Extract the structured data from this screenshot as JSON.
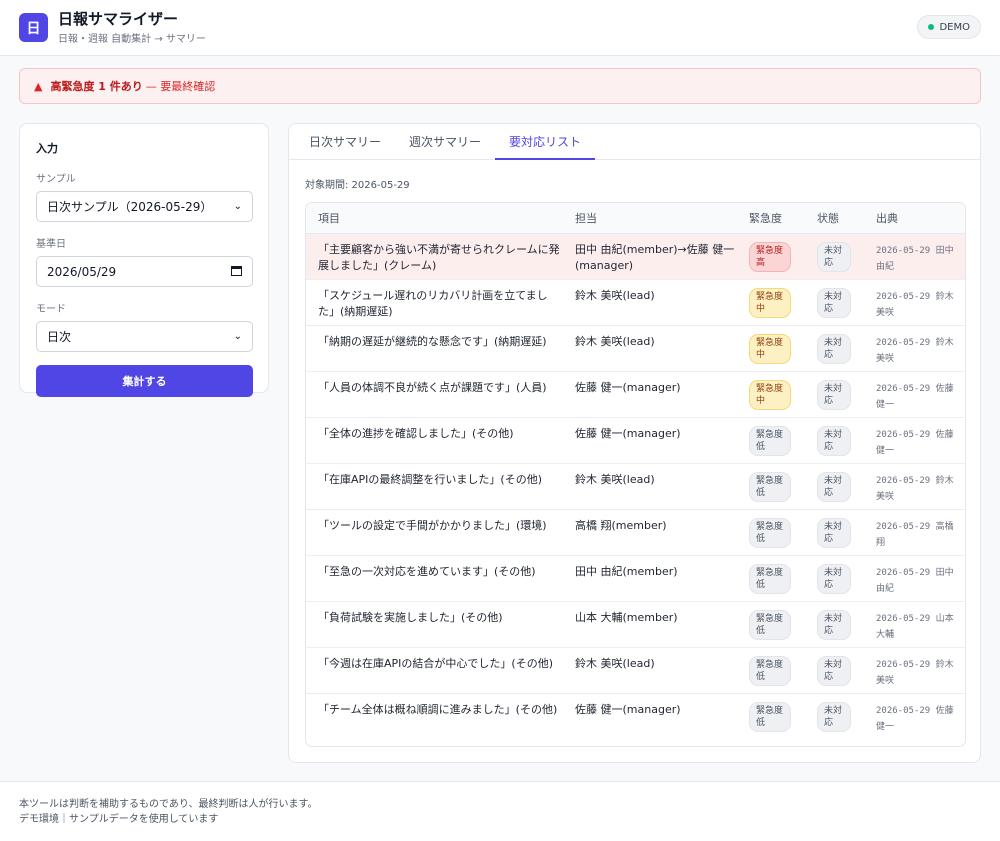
{
  "app": {
    "logo_char": "日",
    "title": "日報サマライザー",
    "subtitle": "日報・週報 自動集計 → サマリー",
    "badge": "DEMO"
  },
  "alert": {
    "strong": "高緊急度 1 件あり",
    "rest": "— 要最終確認"
  },
  "input": {
    "title": "入力",
    "sample_label": "サンプル",
    "sample_value": "日次サンプル（2026-05-29）",
    "date_label": "基準日",
    "date_value": "2026/05/29",
    "mode_label": "モード",
    "mode_value": "日次",
    "submit_label": "集計する"
  },
  "tabs": [
    "日次サマリー",
    "週次サマリー",
    "要対応リスト"
  ],
  "active_tab": 2,
  "period": "対象期間: 2026-05-29",
  "table": {
    "headers": [
      "項目",
      "担当",
      "緊急度",
      "状態",
      "出典"
    ],
    "rows": [
      {
        "item": "「主要顧客から強い不満が寄せられクレームに発展しました」(クレーム)",
        "owner": "田中 由紀(member)→佐藤 健一(manager)",
        "urgency": "緊急度高",
        "level": "high",
        "status": "未対応",
        "source": "2026-05-29 田中 由紀"
      },
      {
        "item": "「スケジュール遅れのリカバリ計画を立てました」(納期遅延)",
        "owner": "鈴木 美咲(lead)",
        "urgency": "緊急度中",
        "level": "mid",
        "status": "未対応",
        "source": "2026-05-29 鈴木 美咲"
      },
      {
        "item": "「納期の遅延が継続的な懸念です」(納期遅延)",
        "owner": "鈴木 美咲(lead)",
        "urgency": "緊急度中",
        "level": "mid",
        "status": "未対応",
        "source": "2026-05-29 鈴木 美咲"
      },
      {
        "item": "「人員の体調不良が続く点が課題です」(人員)",
        "owner": "佐藤 健一(manager)",
        "urgency": "緊急度中",
        "level": "mid",
        "status": "未対応",
        "source": "2026-05-29 佐藤 健一"
      },
      {
        "item": "「全体の進捗を確認しました」(その他)",
        "owner": "佐藤 健一(manager)",
        "urgency": "緊急度低",
        "level": "low",
        "status": "未対応",
        "source": "2026-05-29 佐藤 健一"
      },
      {
        "item": "「在庫APIの最終調整を行いました」(その他)",
        "owner": "鈴木 美咲(lead)",
        "urgency": "緊急度低",
        "level": "low",
        "status": "未対応",
        "source": "2026-05-29 鈴木 美咲"
      },
      {
        "item": "「ツールの設定で手間がかかりました」(環境)",
        "owner": "高橋 翔(member)",
        "urgency": "緊急度低",
        "level": "low",
        "status": "未対応",
        "source": "2026-05-29 高橋 翔"
      },
      {
        "item": "「至急の一次対応を進めています」(その他)",
        "owner": "田中 由紀(member)",
        "urgency": "緊急度低",
        "level": "low",
        "status": "未対応",
        "source": "2026-05-29 田中 由紀"
      },
      {
        "item": "「負荷試験を実施しました」(その他)",
        "owner": "山本 大輔(member)",
        "urgency": "緊急度低",
        "level": "low",
        "status": "未対応",
        "source": "2026-05-29 山本 大輔"
      },
      {
        "item": "「今週は在庫APIの結合が中心でした」(その他)",
        "owner": "鈴木 美咲(lead)",
        "urgency": "緊急度低",
        "level": "low",
        "status": "未対応",
        "source": "2026-05-29 鈴木 美咲"
      },
      {
        "item": "「チーム全体は概ね順調に進みました」(その他)",
        "owner": "佐藤 健一(manager)",
        "urgency": "緊急度低",
        "level": "low",
        "status": "未対応",
        "source": "2026-05-29 佐藤 健一"
      }
    ]
  },
  "footer": {
    "line1": "本ツールは判断を補助するものであり、最終判断は人が行います。",
    "line2": "デモ環境｜サンプルデータを使用しています"
  },
  "colors": {
    "accent": "#4f46e5",
    "danger": "#dc2626",
    "warning": "#f5d97a"
  }
}
